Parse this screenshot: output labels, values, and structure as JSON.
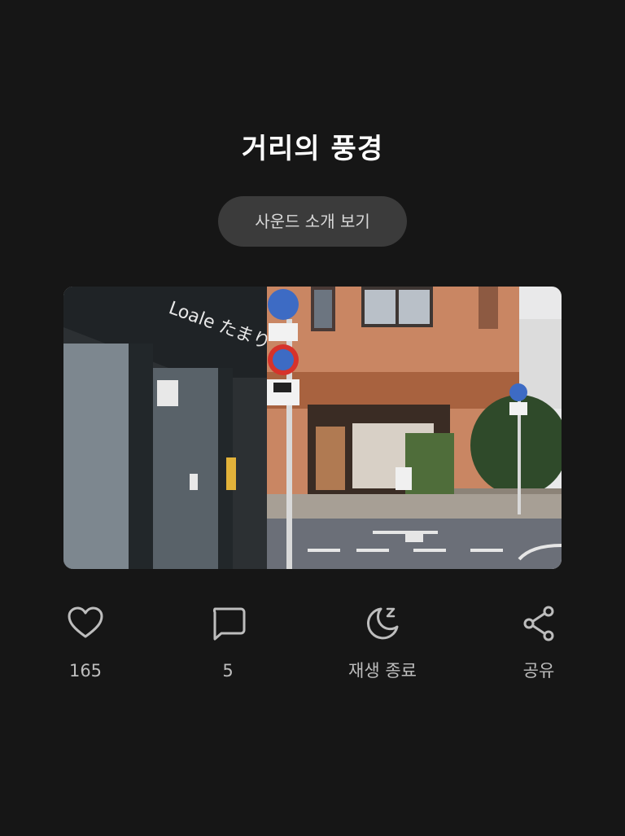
{
  "page": {
    "title": "거리의 풍경",
    "sound_button_label": "사운드 소개 보기"
  },
  "photo": {
    "description_icon": "street-photo",
    "shop_sign_text": "Loale たまり"
  },
  "actions": [
    {
      "icon": "heart-icon",
      "label": "165"
    },
    {
      "icon": "comment-icon",
      "label": "5"
    },
    {
      "icon": "sleep-timer-icon",
      "label": "재생 종료"
    },
    {
      "icon": "share-icon",
      "label": "공유"
    }
  ],
  "colors": {
    "background": "#161616",
    "button_bg": "#3b3b3b",
    "icon": "#bdbdbd"
  }
}
